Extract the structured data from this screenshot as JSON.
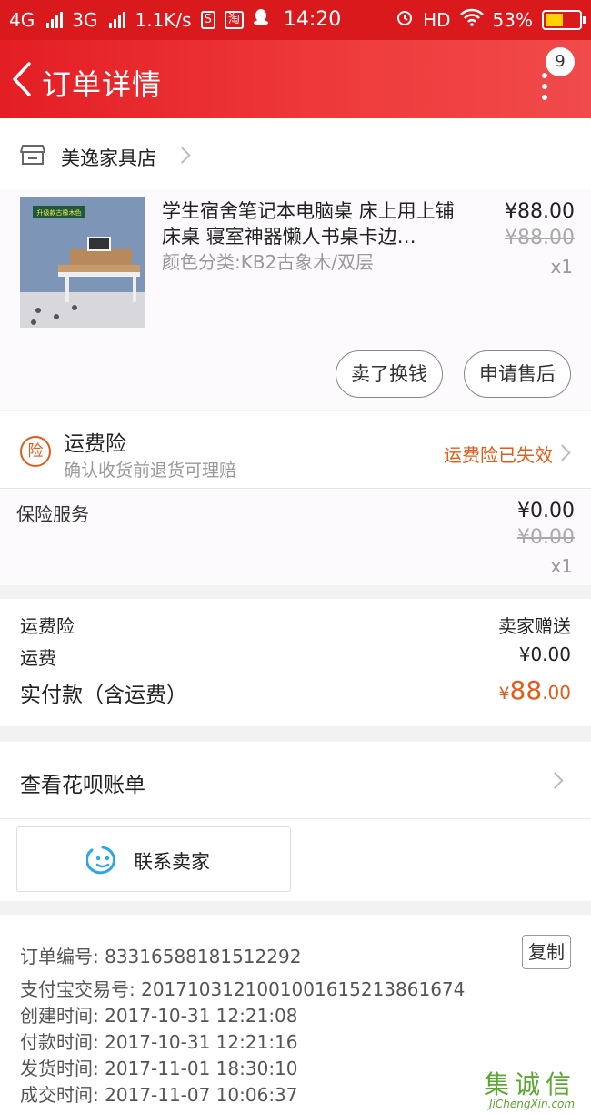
{
  "status_bar": {
    "net1": "4G",
    "net2": "3G",
    "speed": "1.1K/s",
    "tag1": "S",
    "tag2": "淘",
    "time": "14:20",
    "hd": "HD",
    "battery": "53%"
  },
  "nav": {
    "title": "订单详情",
    "badge": "9"
  },
  "shop": {
    "name": "美逸家具店"
  },
  "goods": {
    "title": "学生宿舍笔记本电脑桌 床上用上铺床桌 寝室神器懒人书桌卡边…",
    "sku": "颜色分类:KB2古象木/双层",
    "price": "¥88.00",
    "original_price": "¥88.00",
    "quantity": "x1",
    "image_label": "升级款古橡木色",
    "buttons": {
      "sell": "卖了换钱",
      "after_sale": "申请售后"
    }
  },
  "insurance": {
    "icon_text": "险",
    "title": "运费险",
    "subtitle": "确认收货前退货可理赔",
    "status": "运费险已失效"
  },
  "insurance_service": {
    "label": "保险服务",
    "price": "¥0.00",
    "original_price": "¥0.00",
    "quantity": "x1"
  },
  "summary": {
    "freight_insurance_label": "运费险",
    "freight_insurance_value": "卖家赠送",
    "shipping_label": "运费",
    "shipping_value": "¥0.00",
    "total_label": "实付款（含运费）",
    "total_currency": "¥",
    "total_int": "88",
    "total_dec": ".00"
  },
  "huabei": {
    "label": "查看花呗账单"
  },
  "contact": {
    "label": "联系卖家"
  },
  "order_info": {
    "order_no": "订单编号: 83316588181512292",
    "alipay_no": "支付宝交易号: 2017103121001001615213861674",
    "created": "创建时间: 2017-10-31 12:21:08",
    "paid": "付款时间: 2017-10-31 12:21:16",
    "shipped": "发货时间: 2017-11-01 18:30:10",
    "completed": "成交时间: 2017-11-07 10:06:37",
    "copy_label": "复制"
  },
  "watermark": {
    "main": "集诚信",
    "sub": "JiChengXin.com"
  },
  "colors": {
    "brand_red": "#e31e24",
    "accent_orange": "#e55a16"
  }
}
